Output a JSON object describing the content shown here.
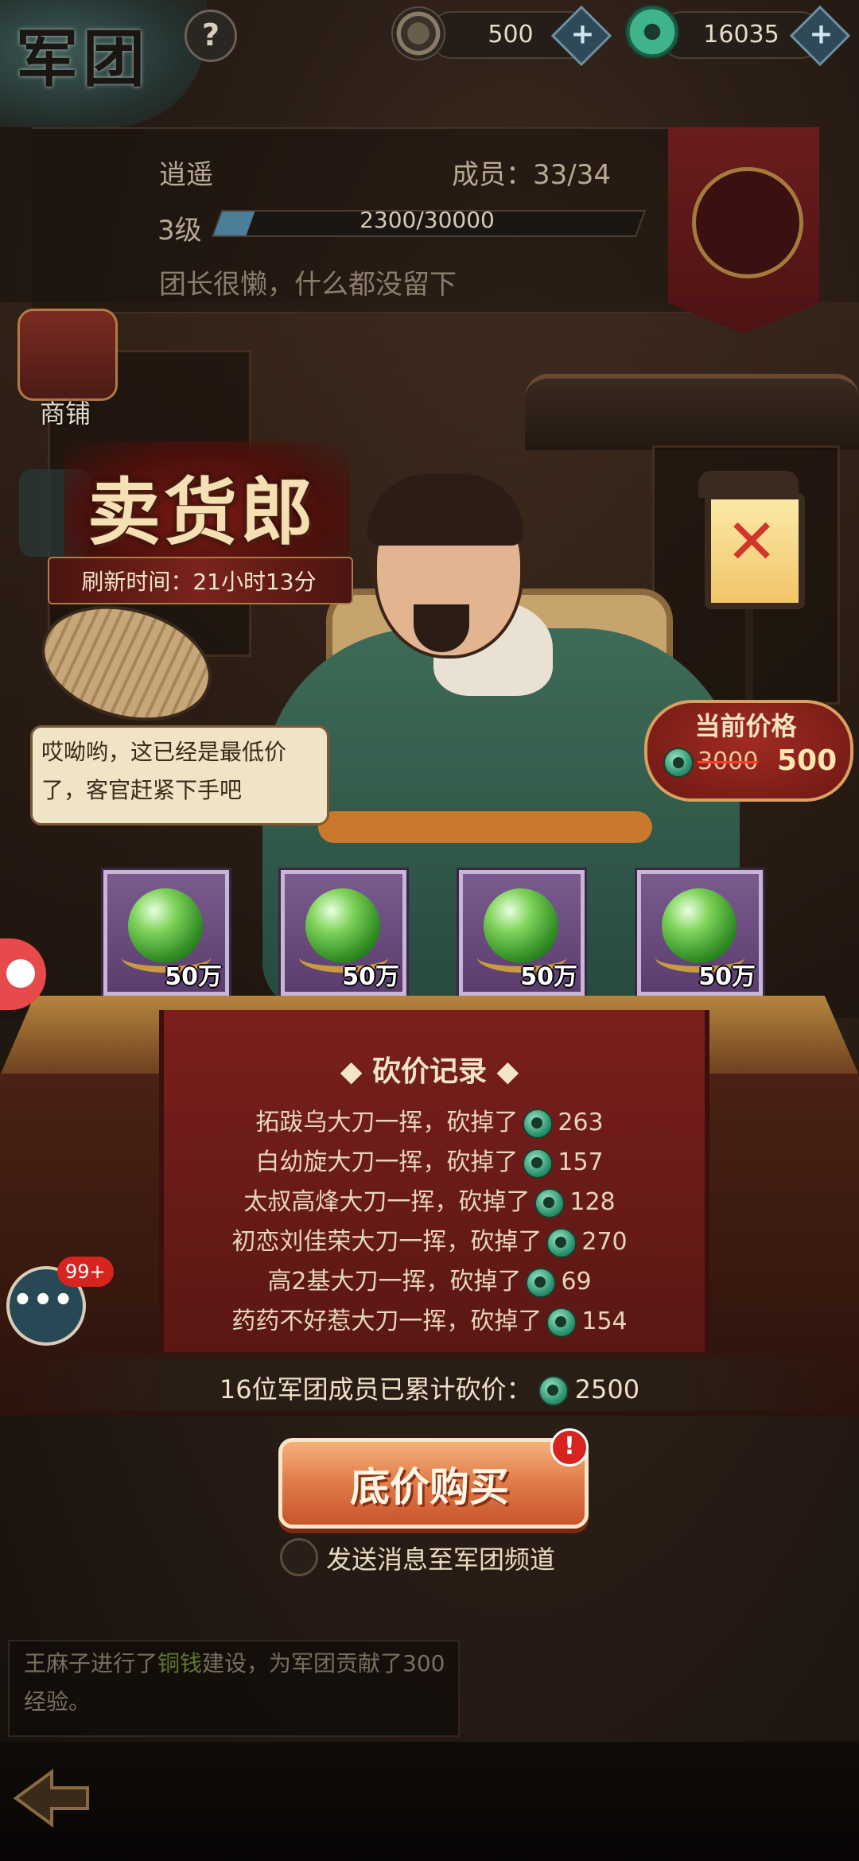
{
  "header": {
    "title": "军团",
    "help_icon": "question-icon",
    "currency1": {
      "icon": "coin-icon",
      "amount": "500",
      "add": "+"
    },
    "currency2": {
      "icon": "jade-icon",
      "amount": "16035",
      "add": "+"
    }
  },
  "guild": {
    "name": "逍遥",
    "members": "成员：33/34",
    "level": "3级",
    "xp_text": "2300/30000",
    "xp_progress": 0.0767,
    "motto": "团长很懒，什么都没留下"
  },
  "side_menu": {
    "shop_label": "商铺"
  },
  "vendor": {
    "name": "卖货郎",
    "refresh": "刷新时间：21小时13分",
    "speech": "哎呦哟，这已经是最低价了，客官赶紧下手吧",
    "lantern_mark": "✕"
  },
  "price": {
    "label": "当前价格",
    "original": "3000",
    "current": "500"
  },
  "items": [
    {
      "icon": "jade-orb-icon",
      "qty": "50万"
    },
    {
      "icon": "jade-orb-icon",
      "qty": "50万"
    },
    {
      "icon": "jade-orb-icon",
      "qty": "50万"
    },
    {
      "icon": "jade-orb-icon",
      "qty": "50万"
    }
  ],
  "log": {
    "title": "砍价记录",
    "entries": [
      {
        "text": "拓跋乌大刀一挥，砍掉了",
        "amount": "263"
      },
      {
        "text": "白幼旋大刀一挥，砍掉了",
        "amount": "157"
      },
      {
        "text": "太叔高烽大刀一挥，砍掉了",
        "amount": "128"
      },
      {
        "text": "初恋刘佳荣大刀一挥，砍掉了",
        "amount": "270"
      },
      {
        "text": "高2基大刀一挥，砍掉了",
        "amount": "69"
      },
      {
        "text": "药药不好惹大刀一挥，砍掉了",
        "amount": "154"
      }
    ],
    "total_text": "16位军团成员已累计砍价：",
    "total_amount": "2500"
  },
  "actions": {
    "buy_label": "底价购买",
    "alert": "!",
    "send_label": "发送消息至军团频道"
  },
  "chat": {
    "badge": "99+",
    "icon": "chat-bubble-icon"
  },
  "ticker": {
    "part1": "王麻子进行了",
    "highlight": "铜钱",
    "part2": "建设，为军团贡献了300经验。"
  },
  "colors": {
    "accent_red": "#7a1f1c",
    "jade_green": "#2f9672",
    "button_orange": "#e07a48",
    "card_purple": "#6a4a7e"
  }
}
